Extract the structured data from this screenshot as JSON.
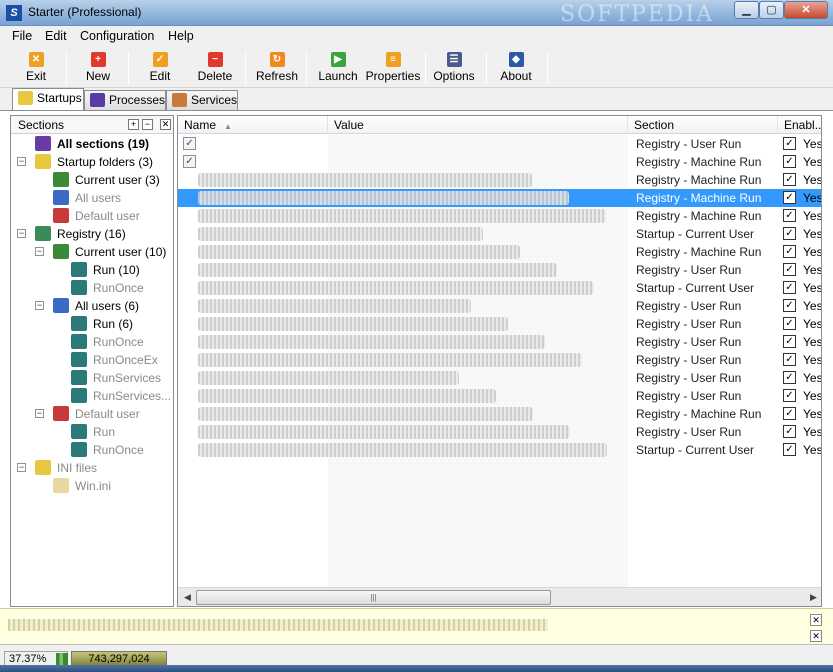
{
  "window": {
    "title": "Starter (Professional)",
    "watermark": "SOFTPEDIA",
    "min_label": "▁",
    "max_label": "▢",
    "close_label": "✕"
  },
  "menu": [
    "File",
    "Edit",
    "Configuration",
    "Help"
  ],
  "toolbar": [
    {
      "label": "Exit",
      "icon": "exit-icon",
      "color": "#f0a020",
      "glyph": "✕"
    },
    {
      "label": "New",
      "icon": "new-icon",
      "color": "#e03a2f",
      "glyph": "+"
    },
    {
      "label": "Edit",
      "icon": "edit-icon",
      "color": "#f0a020",
      "glyph": "✓"
    },
    {
      "label": "Delete",
      "icon": "delete-icon",
      "color": "#e03a2f",
      "glyph": "−"
    },
    {
      "label": "Refresh",
      "icon": "refresh-icon",
      "color": "#f08a20",
      "glyph": "↻"
    },
    {
      "label": "Launch",
      "icon": "launch-icon",
      "color": "#3aa53a",
      "glyph": "▶"
    },
    {
      "label": "Properties",
      "icon": "properties-icon",
      "color": "#f0a020",
      "glyph": "≡"
    },
    {
      "label": "Options",
      "icon": "options-icon",
      "color": "#4a5a8a",
      "glyph": "☰"
    },
    {
      "label": "About",
      "icon": "about-icon",
      "color": "#2a5aa5",
      "glyph": "◆"
    }
  ],
  "tabs": [
    "Startups",
    "Processes",
    "Services"
  ],
  "sections_header": "Sections",
  "tree": [
    {
      "label": "All sections (19)",
      "level": 0,
      "expander": "",
      "bold": true,
      "dim": false,
      "icon_color": "#6a3aa5"
    },
    {
      "label": "Startup folders (3)",
      "level": 0,
      "expander": "−",
      "bold": false,
      "dim": false,
      "icon_color": "#e8c840"
    },
    {
      "label": "Current user (3)",
      "level": 1,
      "expander": "",
      "bold": false,
      "dim": false,
      "icon_color": "#3a8a3a"
    },
    {
      "label": "All users",
      "level": 1,
      "expander": "",
      "bold": false,
      "dim": true,
      "icon_color": "#3a6ac8"
    },
    {
      "label": "Default user",
      "level": 1,
      "expander": "",
      "bold": false,
      "dim": true,
      "icon_color": "#c83a3a"
    },
    {
      "label": "Registry (16)",
      "level": 0,
      "expander": "−",
      "bold": false,
      "dim": false,
      "icon_color": "#3a8a5a"
    },
    {
      "label": "Current user (10)",
      "level": 1,
      "expander": "−",
      "bold": false,
      "dim": false,
      "icon_color": "#3a8a3a"
    },
    {
      "label": "Run (10)",
      "level": 2,
      "expander": "",
      "bold": false,
      "dim": false,
      "icon_color": "#2a7a7a"
    },
    {
      "label": "RunOnce",
      "level": 2,
      "expander": "",
      "bold": false,
      "dim": true,
      "icon_color": "#2a7a7a"
    },
    {
      "label": "All users (6)",
      "level": 1,
      "expander": "−",
      "bold": false,
      "dim": false,
      "icon_color": "#3a6ac8"
    },
    {
      "label": "Run (6)",
      "level": 2,
      "expander": "",
      "bold": false,
      "dim": false,
      "icon_color": "#2a7a7a"
    },
    {
      "label": "RunOnce",
      "level": 2,
      "expander": "",
      "bold": false,
      "dim": true,
      "icon_color": "#2a7a7a"
    },
    {
      "label": "RunOnceEx",
      "level": 2,
      "expander": "",
      "bold": false,
      "dim": true,
      "icon_color": "#2a7a7a"
    },
    {
      "label": "RunServices",
      "level": 2,
      "expander": "",
      "bold": false,
      "dim": true,
      "icon_color": "#2a7a7a"
    },
    {
      "label": "RunServices...",
      "level": 2,
      "expander": "",
      "bold": false,
      "dim": true,
      "icon_color": "#2a7a7a"
    },
    {
      "label": "Default user",
      "level": 1,
      "expander": "−",
      "bold": false,
      "dim": true,
      "icon_color": "#c83a3a"
    },
    {
      "label": "Run",
      "level": 2,
      "expander": "",
      "bold": false,
      "dim": true,
      "icon_color": "#2a7a7a"
    },
    {
      "label": "RunOnce",
      "level": 2,
      "expander": "",
      "bold": false,
      "dim": true,
      "icon_color": "#2a7a7a"
    },
    {
      "label": "INI files",
      "level": 0,
      "expander": "−",
      "bold": false,
      "dim": true,
      "icon_color": "#e8c840"
    },
    {
      "label": "Win.ini",
      "level": 1,
      "expander": "",
      "bold": false,
      "dim": true,
      "icon_color": "#e8d8a0"
    }
  ],
  "columns": [
    "Name",
    "Value",
    "Section",
    "Enabl..."
  ],
  "sort_arrow": "▲",
  "check_mark": "✓",
  "rows": [
    {
      "section": "Registry - User Run",
      "enabled": "Yes",
      "selected": false
    },
    {
      "section": "Registry - Machine Run",
      "enabled": "Yes",
      "selected": false
    },
    {
      "section": "Registry - Machine Run",
      "enabled": "Yes",
      "selected": false
    },
    {
      "section": "Registry - Machine Run",
      "enabled": "Yes",
      "selected": true
    },
    {
      "section": "Registry - Machine Run",
      "enabled": "Yes",
      "selected": false
    },
    {
      "section": "Startup - Current User",
      "enabled": "Yes",
      "selected": false
    },
    {
      "section": "Registry - Machine Run",
      "enabled": "Yes",
      "selected": false
    },
    {
      "section": "Registry - User Run",
      "enabled": "Yes",
      "selected": false
    },
    {
      "section": "Startup - Current User",
      "enabled": "Yes",
      "selected": false
    },
    {
      "section": "Registry - User Run",
      "enabled": "Yes",
      "selected": false
    },
    {
      "section": "Registry - User Run",
      "enabled": "Yes",
      "selected": false
    },
    {
      "section": "Registry - User Run",
      "enabled": "Yes",
      "selected": false
    },
    {
      "section": "Registry - User Run",
      "enabled": "Yes",
      "selected": false
    },
    {
      "section": "Registry - User Run",
      "enabled": "Yes",
      "selected": false
    },
    {
      "section": "Registry - User Run",
      "enabled": "Yes",
      "selected": false
    },
    {
      "section": "Registry - Machine Run",
      "enabled": "Yes",
      "selected": false
    },
    {
      "section": "Registry - User Run",
      "enabled": "Yes",
      "selected": false
    },
    {
      "section": "Startup - Current User",
      "enabled": "Yes",
      "selected": false
    }
  ],
  "scroll": {
    "left": "◀",
    "right": "▶",
    "grip": "|||"
  },
  "info_close": "✕",
  "status": {
    "cpu": "37.37%",
    "memory": "743,297,024"
  }
}
